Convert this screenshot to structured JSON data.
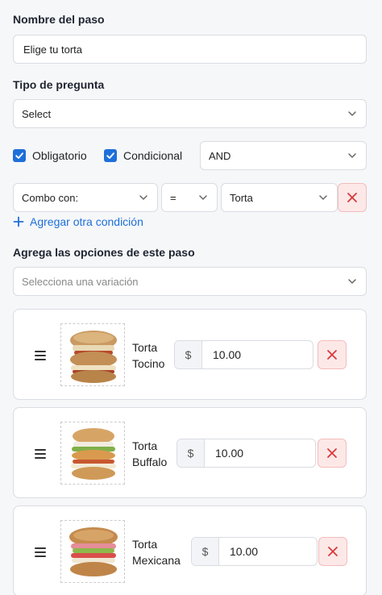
{
  "step_name": {
    "label": "Nombre del paso",
    "value": "Elige tu torta"
  },
  "question_type": {
    "label": "Tipo de pregunta",
    "value": "Select"
  },
  "required": {
    "label": "Obligatorio",
    "checked": true
  },
  "conditional": {
    "label": "Condicional",
    "checked": true
  },
  "logic_operator": "AND",
  "condition": {
    "field": "Combo con:",
    "operator": "=",
    "value": "Torta"
  },
  "add_condition_label": "Agregar otra condición",
  "options_section": {
    "label": "Agrega las opciones de este paso",
    "placeholder": "Selecciona una variación"
  },
  "options": [
    {
      "line1": "Torta",
      "line2": "Tocino",
      "currency": "$",
      "price": "10.00"
    },
    {
      "line1": "Torta",
      "line2": "Buffalo",
      "currency": "$",
      "price": "10.00"
    },
    {
      "line1": "Torta",
      "line2": "Mexicana",
      "currency": "$",
      "price": "10.00"
    }
  ],
  "colors": {
    "accent": "#1e6fd9",
    "danger": "#d63b3b",
    "danger_bg": "#fde8e8"
  },
  "icons": {
    "chevron": "chevron-down-icon",
    "check": "check-icon",
    "remove": "close-icon",
    "drag": "drag-handle-icon",
    "add": "plus-icon"
  }
}
